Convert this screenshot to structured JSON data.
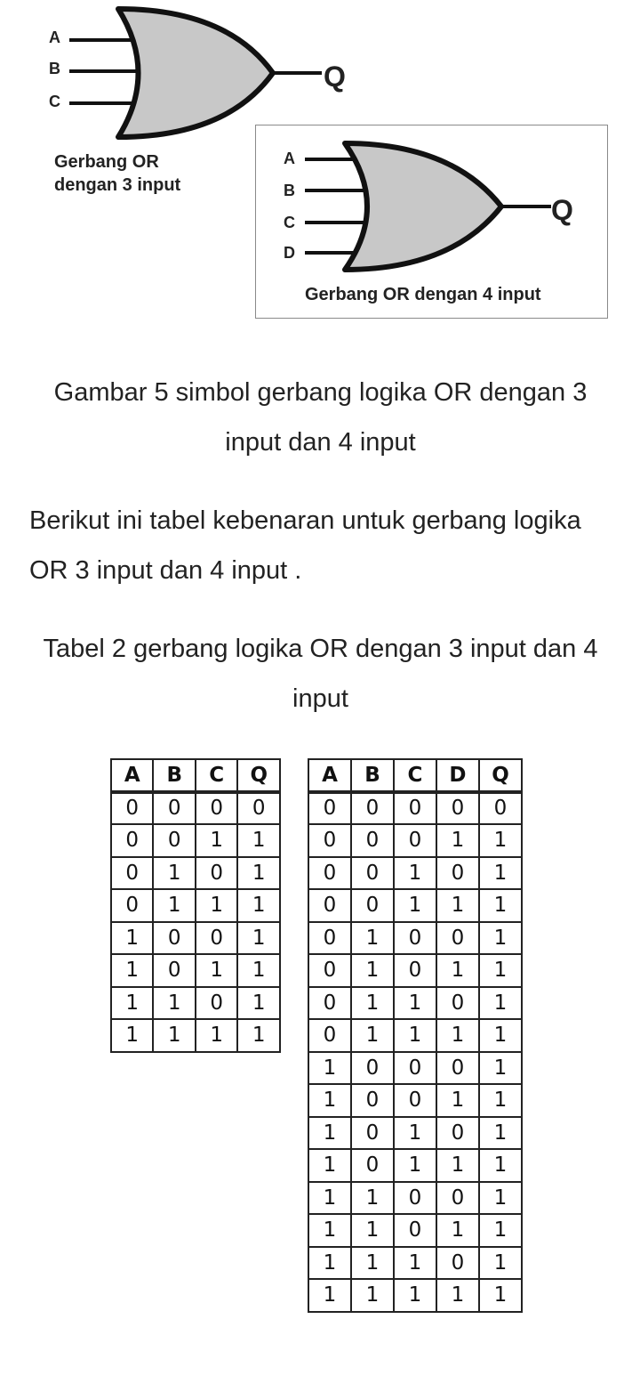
{
  "gate3": {
    "inputs": [
      "A",
      "B",
      "C"
    ],
    "output": "Q",
    "caption_line1": "Gerbang OR",
    "caption_line2": "dengan 3 input"
  },
  "gate4": {
    "inputs": [
      "A",
      "B",
      "C",
      "D"
    ],
    "output": "Q",
    "caption": "Gerbang OR dengan 4 input"
  },
  "figure_caption": "Gambar 5 simbol gerbang logika OR dengan 3 input dan 4 input",
  "intro_text": "Berikut ini tabel kebenaran untuk gerbang logika OR 3 input dan 4 input .",
  "table_caption": "Tabel 2 gerbang logika OR dengan 3 input dan 4 input",
  "table3": {
    "headers": [
      "A",
      "B",
      "C",
      "Q"
    ],
    "rows": [
      [
        "0",
        "0",
        "0",
        "0"
      ],
      [
        "0",
        "0",
        "1",
        "1"
      ],
      [
        "0",
        "1",
        "0",
        "1"
      ],
      [
        "0",
        "1",
        "1",
        "1"
      ],
      [
        "1",
        "0",
        "0",
        "1"
      ],
      [
        "1",
        "0",
        "1",
        "1"
      ],
      [
        "1",
        "1",
        "0",
        "1"
      ],
      [
        "1",
        "1",
        "1",
        "1"
      ]
    ]
  },
  "table4": {
    "headers": [
      "A",
      "B",
      "C",
      "D",
      "Q"
    ],
    "rows": [
      [
        "0",
        "0",
        "0",
        "0",
        "0"
      ],
      [
        "0",
        "0",
        "0",
        "1",
        "1"
      ],
      [
        "0",
        "0",
        "1",
        "0",
        "1"
      ],
      [
        "0",
        "0",
        "1",
        "1",
        "1"
      ],
      [
        "0",
        "1",
        "0",
        "0",
        "1"
      ],
      [
        "0",
        "1",
        "0",
        "1",
        "1"
      ],
      [
        "0",
        "1",
        "1",
        "0",
        "1"
      ],
      [
        "0",
        "1",
        "1",
        "1",
        "1"
      ],
      [
        "1",
        "0",
        "0",
        "0",
        "1"
      ],
      [
        "1",
        "0",
        "0",
        "1",
        "1"
      ],
      [
        "1",
        "0",
        "1",
        "0",
        "1"
      ],
      [
        "1",
        "0",
        "1",
        "1",
        "1"
      ],
      [
        "1",
        "1",
        "0",
        "0",
        "1"
      ],
      [
        "1",
        "1",
        "0",
        "1",
        "1"
      ],
      [
        "1",
        "1",
        "1",
        "0",
        "1"
      ],
      [
        "1",
        "1",
        "1",
        "1",
        "1"
      ]
    ]
  }
}
